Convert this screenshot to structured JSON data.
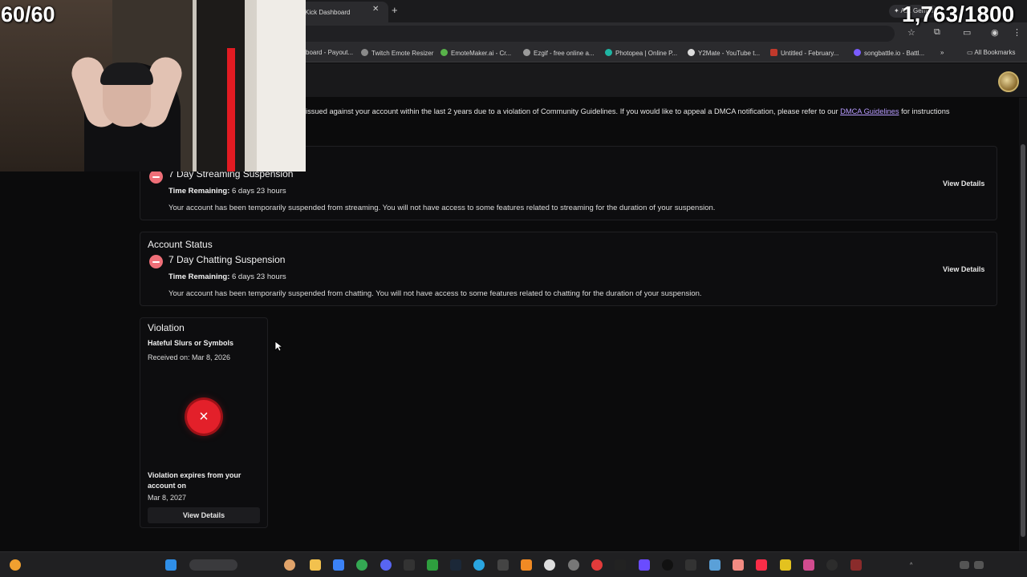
{
  "overlay": {
    "fps": "60/60",
    "counter": "1,763/1800"
  },
  "browser": {
    "tab_title": "Kick Dashboard",
    "gemini_chip": "Ask Gemini",
    "bookmarks": [
      "board - Payout...",
      "Twitch Emote Resizer",
      "EmoteMaker.ai - Cr...",
      "Ezgif - free online a...",
      "Photopea | Online P...",
      "Y2Mate - YouTube t...",
      "Untitled - February...",
      "songbattle.io - Battl..."
    ],
    "all_bookmarks": "All Bookmarks"
  },
  "notice": {
    "text": "issued against your account within the last 2 years due to a violation of Community Guidelines. If you would like to appeal a DMCA notification, please refer to our ",
    "link": "DMCA Guidelines",
    "suffix": " for instructions"
  },
  "streaming_card": {
    "title": "7 Day Streaming Suspension",
    "time_label": "Time Remaining:",
    "time_value": " 6 days 23 hours",
    "description": "Your account has been temporarily suspended from streaming. You will not have access to some features related to streaming for the duration of your suspension.",
    "button": "View Details"
  },
  "chatting_card": {
    "heading": "Account Status",
    "title": "7 Day Chatting Suspension",
    "time_label": "Time Remaining:",
    "time_value": " 6 days 23 hours",
    "description": "Your account has been temporarily suspended from chatting. You will not have access to some features related to chatting for the duration of your suspension.",
    "button": "View Details"
  },
  "violation": {
    "title": "Violation",
    "reason": "Hateful Slurs or Symbols",
    "received": "Received on: Mar 8, 2026",
    "status_icon": "×",
    "expires_label": "Violation expires from your account on",
    "expires_date": "Mar 8, 2027",
    "button": "View Details"
  },
  "colors": {
    "accent_link": "#b79cff",
    "suspension_icon": "#ef6f78",
    "violation_icon": "#e3202a"
  }
}
